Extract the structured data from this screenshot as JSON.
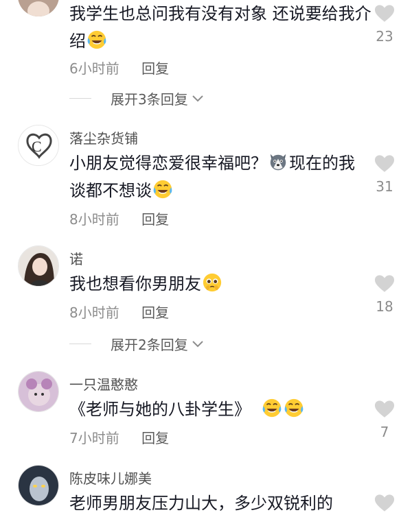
{
  "comments": [
    {
      "author": "",
      "text_parts": [
        "我学生也总问我有没有对象  还说要给我介绍"
      ],
      "emoji_after": [
        "laugh-cry"
      ],
      "time": "6小时前",
      "reply_label": "回复",
      "likes": "23",
      "expand_label": "展开3条回复"
    },
    {
      "author": "落尘杂货铺",
      "text_before": "小朋友觉得恋爱很幸福吧？",
      "text_after": "现在的我谈都不想谈",
      "time": "8小时前",
      "reply_label": "回复",
      "likes": "31"
    },
    {
      "author": "诺",
      "text": "我也想看你男朋友",
      "time": "8小时前",
      "reply_label": "回复",
      "likes": "18",
      "expand_label": "展开2条回复"
    },
    {
      "author": "一只温憨憨",
      "text": "《老师与她的八卦学生》",
      "time": "7小时前",
      "reply_label": "回复",
      "likes": "7"
    },
    {
      "author": "陈皮味儿娜美",
      "text": "老师男朋友压力山大，多少双锐利的"
    }
  ],
  "colors": {
    "primary_text": "#161823",
    "secondary_text": "#8c8c8c",
    "heart": "#d3d3d3"
  },
  "icons": [
    "heart-icon",
    "chevron-down-icon",
    "laugh-cry-emoji",
    "husky-emoji",
    "pleading-emoji"
  ]
}
